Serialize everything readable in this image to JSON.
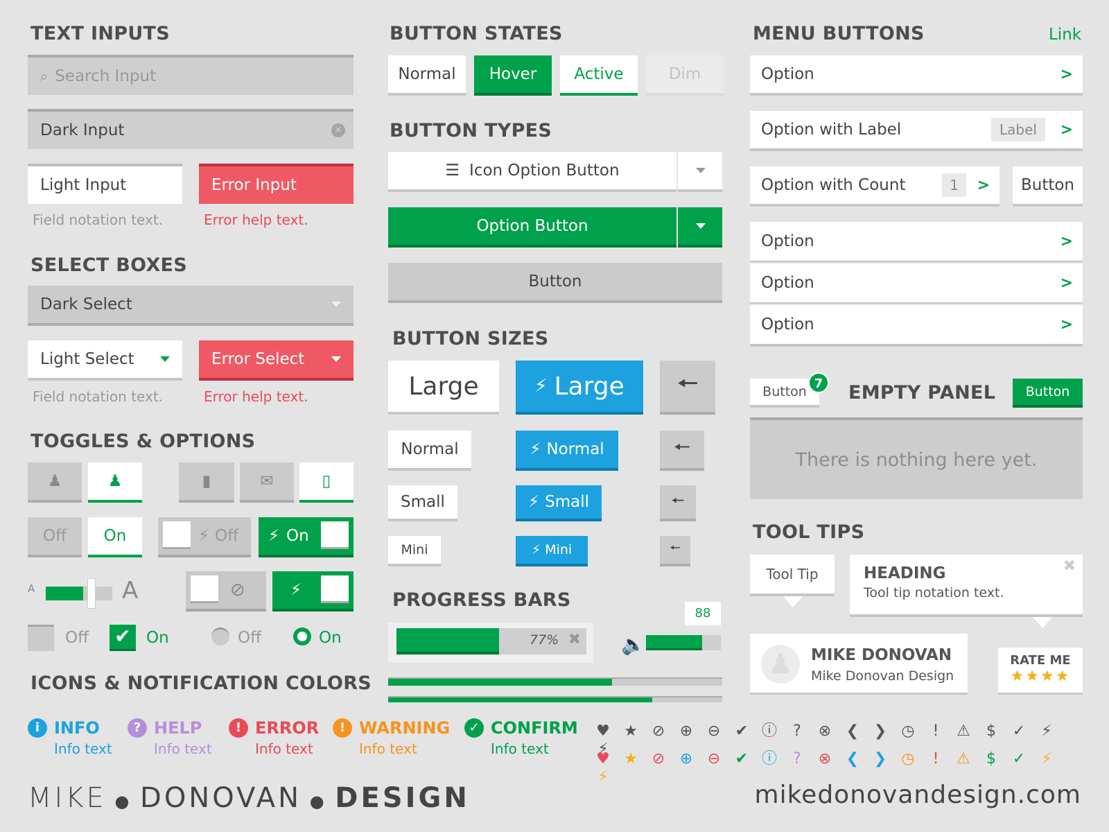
{
  "text_inputs": {
    "heading": "TEXT INPUTS",
    "search_placeholder": "Search Input",
    "dark_input": "Dark Input",
    "light_input": "Light Input",
    "error_input": "Error Input",
    "field_note": "Field notation text.",
    "error_help": "Error help text."
  },
  "select_boxes": {
    "heading": "SELECT BOXES",
    "dark_select": "Dark Select",
    "light_select": "Light Select",
    "error_select": "Error Select",
    "field_note": "Field notation text.",
    "error_help": "Error help text."
  },
  "toggles": {
    "heading": "TOGGLES & OPTIONS",
    "off": "Off",
    "on": "On",
    "slider_small": "A",
    "slider_large": "A",
    "slider_level": 0.85
  },
  "button_states": {
    "heading": "BUTTON STATES",
    "normal": "Normal",
    "hover": "Hover",
    "active": "Active",
    "dim": "Dim"
  },
  "button_types": {
    "heading": "BUTTON TYPES",
    "icon_option": "Icon Option Button",
    "option": "Option Button",
    "button": "Button"
  },
  "button_sizes": {
    "heading": "BUTTON SIZES",
    "large": "Large",
    "normal": "Normal",
    "small": "Small",
    "mini": "Mini"
  },
  "progress": {
    "heading": "PROGRESS BARS",
    "percent_label": "77%",
    "percent": 0.77,
    "volume_label": "88",
    "volume": 0.88,
    "bar1": 0.67,
    "bar2": 0.79
  },
  "menu_buttons": {
    "heading": "MENU BUTTONS",
    "link": "Link",
    "option": "Option",
    "option_label": "Option with Label",
    "label": "Label",
    "option_count": "Option with Count",
    "count": "1",
    "button": "Button"
  },
  "empty_panel": {
    "button_left": "Button",
    "badge": "7",
    "title": "EMPTY PANEL",
    "button_right": "Button",
    "message": "There is nothing here yet."
  },
  "tooltips": {
    "heading": "TOOL TIPS",
    "tip": "Tool Tip",
    "tip_heading": "HEADING",
    "tip_text": "Tool tip notation text.",
    "name": "MIKE DONOVAN",
    "company": "Mike Donovan Design",
    "rate": "RATE ME",
    "stars": 4
  },
  "icons": {
    "heading": "ICONS & NOTIFICATION COLORS",
    "notices": [
      {
        "label": "INFO",
        "text": "Info text",
        "color": "#1da1df",
        "glyph": "i"
      },
      {
        "label": "HELP",
        "text": "Info text",
        "color": "#b68fd9",
        "glyph": "?"
      },
      {
        "label": "ERROR",
        "text": "Info text",
        "color": "#e84c56",
        "glyph": "!"
      },
      {
        "label": "WARNING",
        "text": "Info text",
        "color": "#f7931e",
        "glyph": "!"
      },
      {
        "label": "CONFIRM",
        "text": "Info text",
        "color": "#00a14b",
        "glyph": "✓"
      }
    ]
  },
  "footer": {
    "brand_a": "MIKE",
    "brand_b": "DONOVAN",
    "brand_c": "DESIGN",
    "url": "mikedonovandesign.com"
  }
}
